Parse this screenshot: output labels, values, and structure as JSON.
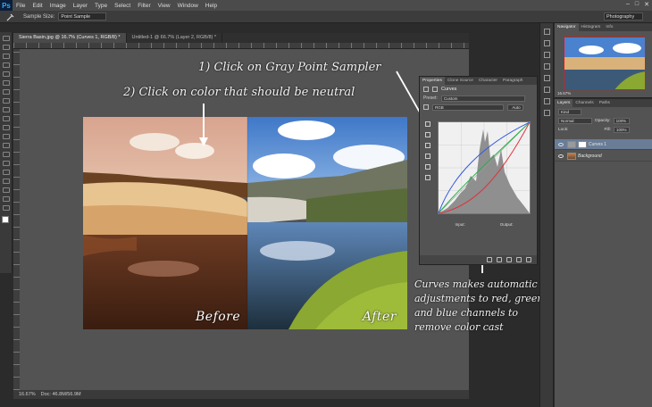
{
  "app": {
    "logo": "Ps"
  },
  "menu": [
    "File",
    "Edit",
    "Image",
    "Layer",
    "Type",
    "Select",
    "Filter",
    "View",
    "Window",
    "Help"
  ],
  "window_controls": [
    "–",
    "□",
    "✕"
  ],
  "options_bar": {
    "sample_size_label": "Sample Size:",
    "sample_size_value": "Point Sample",
    "workspace": "Photography"
  },
  "doc_tabs": [
    {
      "label": "Sierra Basin.jpg @ 16.7% (Curves 1, RGB/8) *",
      "active": true
    },
    {
      "label": "Untitled-1 @ 66.7% (Layer 2, RGB/8) *",
      "active": false
    }
  ],
  "status_bar": {
    "zoom": "16.67%",
    "doc": "Doc: 46.8M/56.9M"
  },
  "annotations": {
    "step1": "1) Click on Gray Point Sampler",
    "step2": "2) Click on color that should be neutral",
    "curves_note": [
      "Curves makes automatic",
      "adjustments to red, green",
      "and blue channels to",
      "remove color cast"
    ]
  },
  "photo": {
    "before_label": "Before",
    "after_label": "After"
  },
  "properties_panel": {
    "tabs": [
      "Properties",
      "Clone Source",
      "Character",
      "Paragraph"
    ],
    "title": "Curves",
    "preset_label": "Preset:",
    "preset_value": "Custom",
    "channel_value": "RGB",
    "auto_button": "Auto",
    "input_label": "Input:",
    "output_label": "Output:"
  },
  "navigator_panel": {
    "tabs": [
      "Navigator",
      "Histogram",
      "Info"
    ],
    "zoom": "16.67%"
  },
  "layers_panel": {
    "tabs": [
      "Layers",
      "Channels",
      "Paths"
    ],
    "kind_value": "Kind",
    "blend_mode": "Normal",
    "opacity_label": "Opacity:",
    "opacity_value": "100%",
    "lock_label": "Lock:",
    "fill_label": "Fill:",
    "fill_value": "100%",
    "layers": [
      {
        "name": "Curves 1",
        "selected": true
      },
      {
        "name": "Background",
        "selected": false
      }
    ]
  },
  "colors": {
    "accent_selected_layer": "#6a7d97",
    "panel_bg": "#535353",
    "app_bg": "#2b2b2b"
  }
}
